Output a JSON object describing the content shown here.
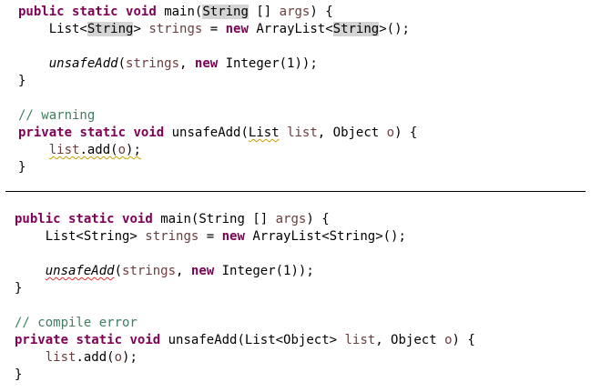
{
  "top": {
    "l1": {
      "kw1": "public",
      "kw2": "static",
      "kw3": "void",
      "name": "main(",
      "type": "String",
      "rest": " [] ",
      "param": "args",
      "end": ") {"
    },
    "l2": {
      "indent": "    ",
      "a": "List<",
      "type": "String",
      "b": "> ",
      "var": "strings",
      "c": " = ",
      "kw": "new",
      "d": " ArrayList<",
      "type2": "String",
      "e": ">();"
    },
    "l3": "",
    "l4": {
      "indent": "    ",
      "call": "unsafeAdd",
      "a": "(",
      "var": "strings",
      "b": ", ",
      "kw": "new",
      "c": " Integer(1));"
    },
    "l5": "}",
    "l6": "",
    "l7": "// warning",
    "l8": {
      "kw1": "private",
      "kw2": "static",
      "kw3": "void",
      "name": " unsafeAdd(",
      "type": "List",
      "b": " ",
      "p1": "list",
      "c": ", Object ",
      "p2": "o",
      "end": ") {"
    },
    "l9": {
      "indent": "    ",
      "var": "list",
      "a": ".add(",
      "p": "o",
      "b": ");"
    },
    "l10": "}"
  },
  "bottom": {
    "l1": {
      "kw1": "public",
      "kw2": "static",
      "kw3": "void",
      "name": "main(String [] ",
      "param": "args",
      "end": ") {"
    },
    "l2": {
      "indent": "    ",
      "a": "List<String> ",
      "var": "strings",
      "c": " = ",
      "kw": "new",
      "d": " ArrayList<String>();"
    },
    "l3": "",
    "l4": {
      "indent": "    ",
      "call": "unsafeAdd",
      "a": "(",
      "var": "strings",
      "b": ", ",
      "kw": "new",
      "c": " Integer(1));"
    },
    "l5": "}",
    "l6": "",
    "l7": "// compile error",
    "l8": {
      "kw1": "private",
      "kw2": "static",
      "kw3": "void",
      "name": " unsafeAdd(List<Object> ",
      "p1": "list",
      "c": ", Object ",
      "p2": "o",
      "end": ") {"
    },
    "l9": {
      "indent": "    ",
      "var": "list",
      "a": ".add(",
      "p": "o",
      "b": ");"
    },
    "l10": "}"
  },
  "colors": {
    "keyword": "#7f0055",
    "local_variable": "#6a3e3e",
    "comment": "#3f7f5f",
    "highlight": "#d4d4d4",
    "warning_underline": "#c8a000",
    "error_underline": "#e03030"
  }
}
